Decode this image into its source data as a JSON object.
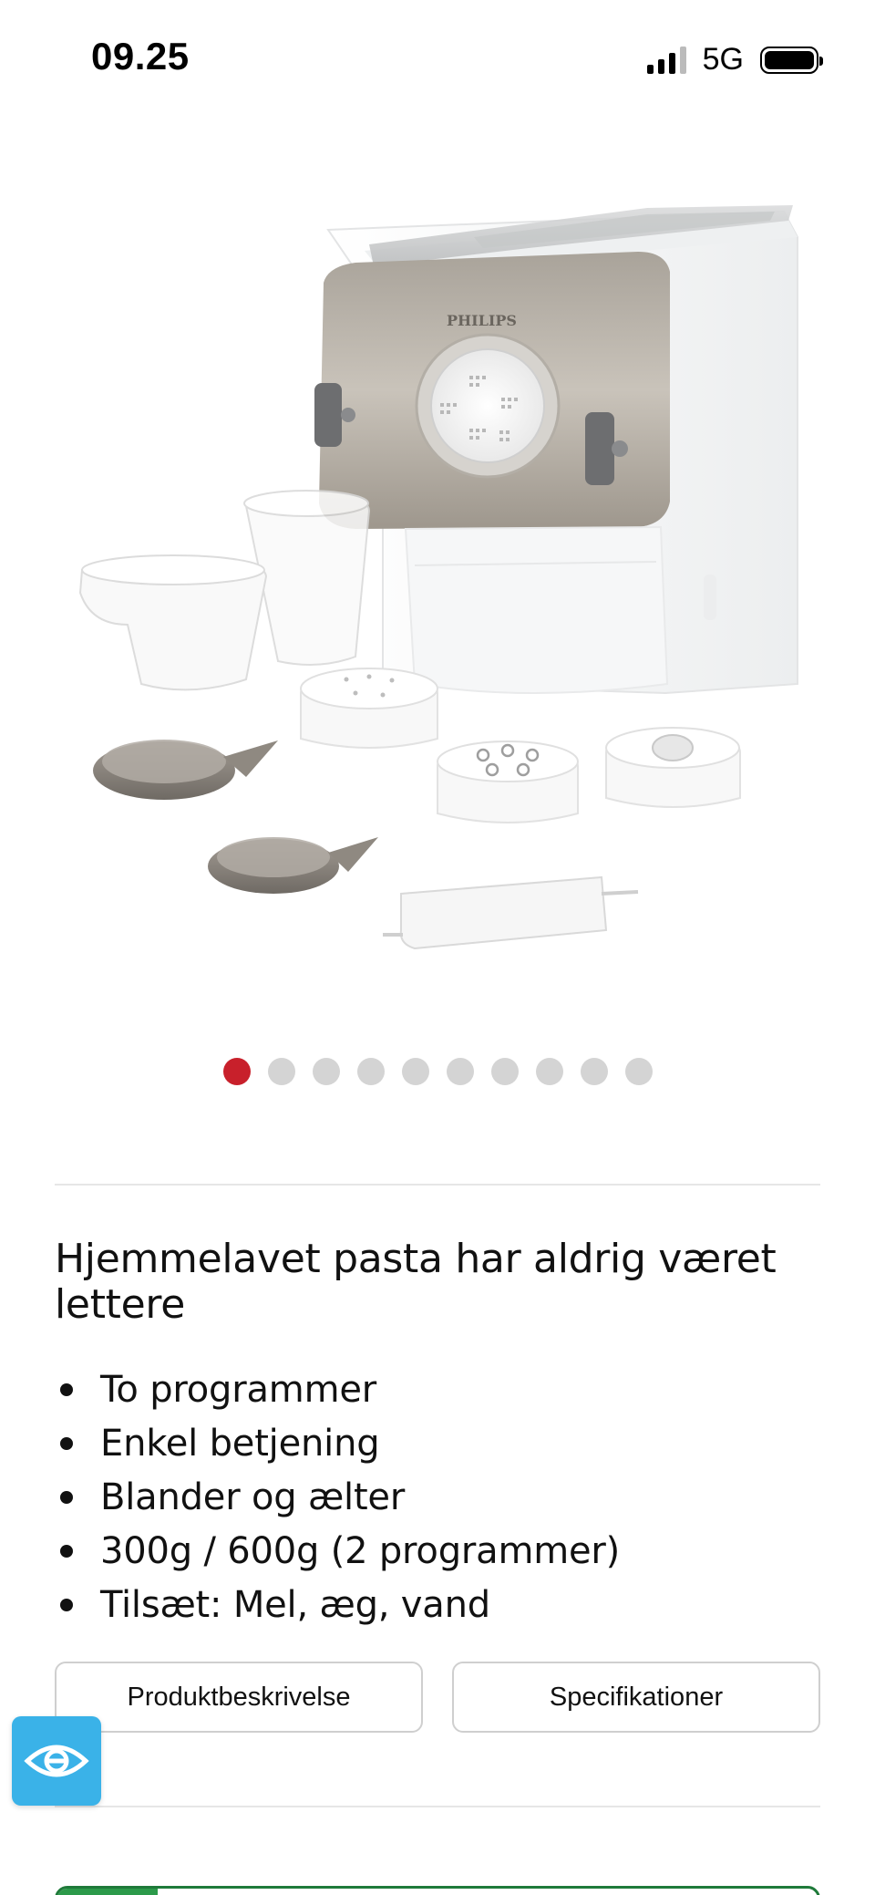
{
  "status_bar": {
    "time": "09.25",
    "network": "5G",
    "signal_bars": 4,
    "signal_bars_active": 3
  },
  "product": {
    "brand": "PHILIPS",
    "image_icon": "pasta-maker-product-image"
  },
  "carousel": {
    "total": 10,
    "active_index": 0,
    "active_color": "#c8202b",
    "inactive_color": "#d4d4d4"
  },
  "headline": "Hjemmelavet pasta har aldrig været lettere",
  "features": [
    "To programmer",
    "Enkel betjening",
    "Blander og ælter",
    "300g / 600g (2 programmer)",
    "Tilsæt: Mel, æg, vand"
  ],
  "buttons": {
    "description": "Produktbeskrivelse",
    "specifications": "Specifikationer"
  },
  "accessibility": {
    "icon": "eye-icon",
    "color": "#3ab2e8"
  },
  "colors": {
    "accent": "#c8202b",
    "bottom_bar": "#2c9a4a"
  }
}
